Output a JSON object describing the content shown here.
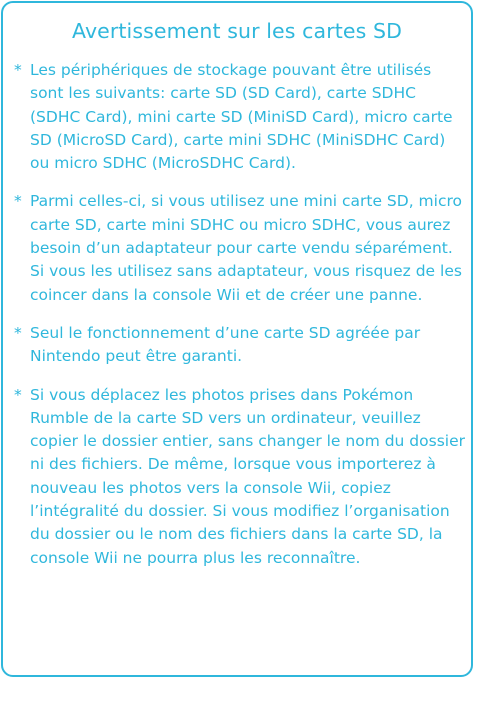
{
  "panel": {
    "title": "Avertissement sur les cartes SD",
    "bullet": "*",
    "accent_color": "#2fb7dc",
    "notes": [
      "Les périphériques de stockage pouvant être utilisés sont les suivants: carte SD (SD Card), carte SDHC (SDHC Card), mini carte SD (MiniSD Card), micro carte SD (MicroSD Card), carte mini SDHC (MiniSDHC Card) ou micro SDHC (MicroSDHC Card).",
      "Parmi celles-ci, si vous utilisez une mini carte SD, micro carte SD, carte mini SDHC ou micro SDHC, vous aurez besoin d’un adaptateur pour carte vendu séparément. Si vous les utilisez sans adaptateur, vous risquez de les coincer dans la console Wii et de créer une panne.",
      "Seul le fonctionnement d’une carte SD agréée par Nintendo peut être garanti.",
      "Si vous déplacez les photos prises dans Pokémon Rumble de la carte SD vers un ordinateur, veuillez copier le dossier entier, sans changer le nom du dossier ni des fichiers. De même, lorsque vous importerez à nouveau les photos vers la console Wii, copiez l’intégralité du dossier. Si vous modifiez l’organisation du dossier ou le nom des fichiers dans la carte SD, la console Wii ne pourra plus les reconnaître."
    ]
  }
}
